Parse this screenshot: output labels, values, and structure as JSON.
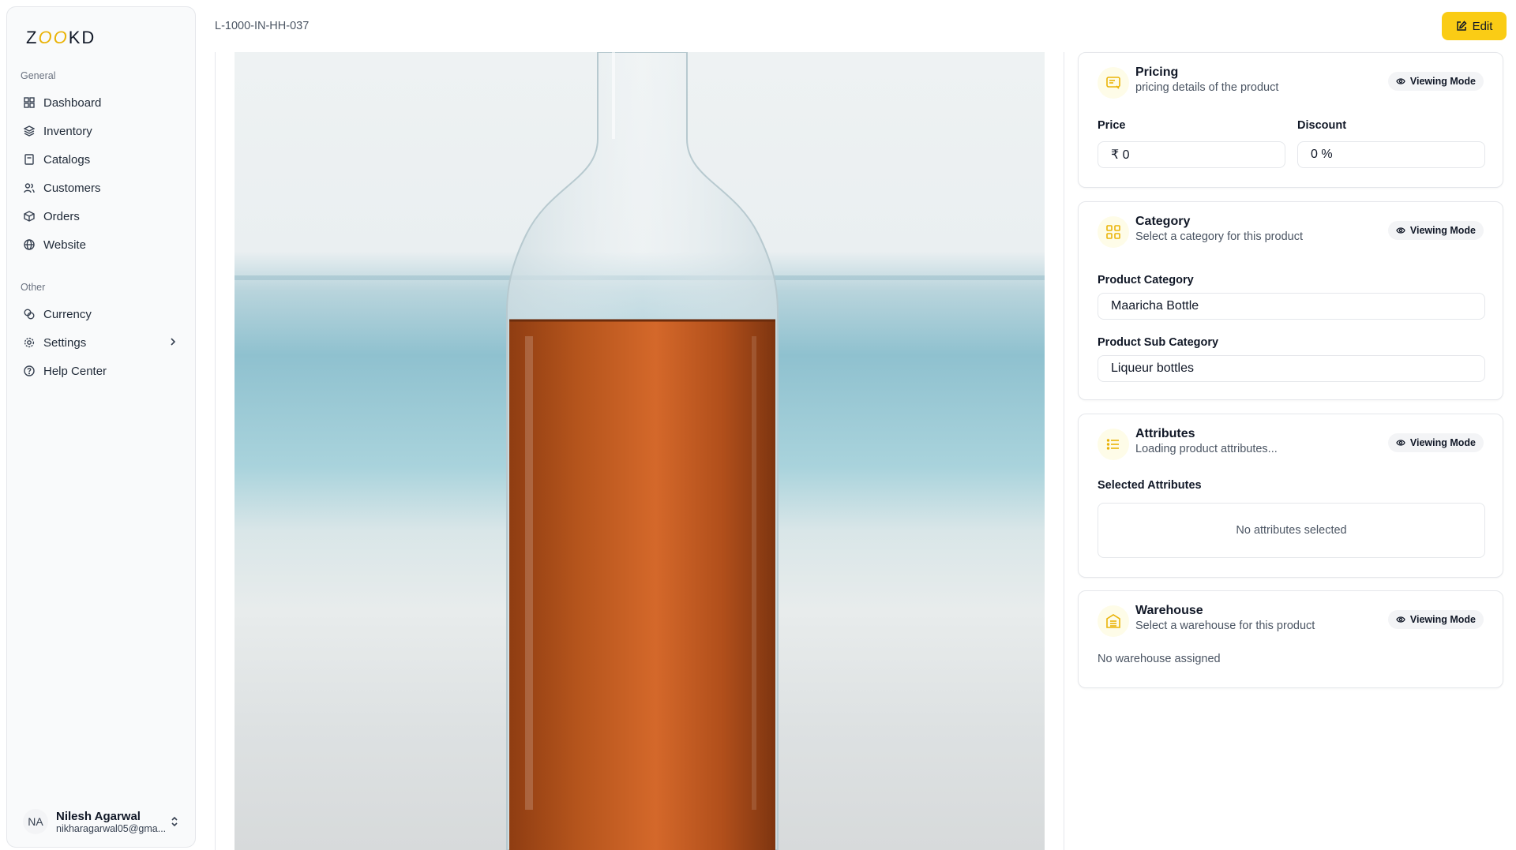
{
  "brand": {
    "logo_prefix": "Z",
    "logo_oo": "OO",
    "logo_suffix": "KD"
  },
  "sidebar": {
    "general_label": "General",
    "general_items": [
      {
        "label": "Dashboard",
        "icon": "dashboard-icon"
      },
      {
        "label": "Inventory",
        "icon": "layers-icon"
      },
      {
        "label": "Catalogs",
        "icon": "book-icon"
      },
      {
        "label": "Customers",
        "icon": "users-icon"
      },
      {
        "label": "Orders",
        "icon": "package-icon"
      },
      {
        "label": "Website",
        "icon": "globe-icon"
      }
    ],
    "other_label": "Other",
    "other_items": [
      {
        "label": "Currency",
        "icon": "coins-icon"
      },
      {
        "label": "Settings",
        "icon": "gear-icon"
      },
      {
        "label": "Help Center",
        "icon": "help-circle-icon"
      }
    ],
    "user": {
      "initials": "NA",
      "name": "Nilesh Agarwal",
      "email": "nikharagarwal05@gma..."
    }
  },
  "header": {
    "breadcrumb": "L-1000-IN-HH-037",
    "edit_label": "Edit"
  },
  "image": {
    "alt": "product-image"
  },
  "pricing": {
    "title": "Pricing",
    "subtitle": "pricing details of the product",
    "mode": "Viewing Mode",
    "price_label": "Price",
    "price_value": "₹ 0",
    "discount_label": "Discount",
    "discount_value": "0 %"
  },
  "category": {
    "title": "Category",
    "subtitle": "Select a category for this product",
    "mode": "Viewing Mode",
    "product_category_label": "Product Category",
    "product_category_value": "Maaricha Bottle",
    "sub_category_label": "Product Sub Category",
    "sub_category_value": "Liqueur bottles"
  },
  "attributes": {
    "title": "Attributes",
    "subtitle": "Loading product attributes...",
    "mode": "Viewing Mode",
    "selected_label": "Selected Attributes",
    "empty_text": "No attributes selected"
  },
  "warehouse": {
    "title": "Warehouse",
    "subtitle": "Select a warehouse for this product",
    "mode": "Viewing Mode",
    "empty_text": "No warehouse assigned"
  },
  "colors": {
    "accent": "#facc15",
    "bottle_liquid": "#b4541c"
  }
}
